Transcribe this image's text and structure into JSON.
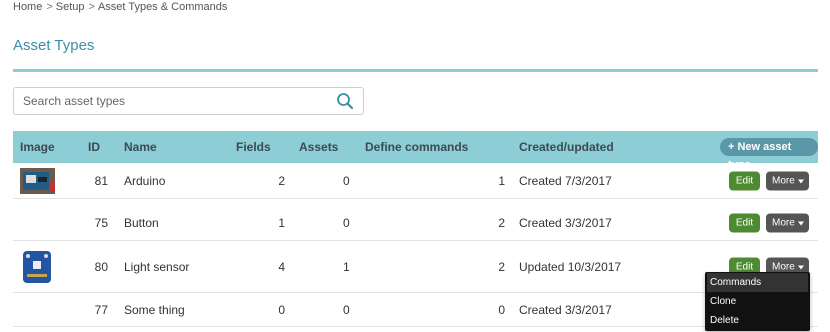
{
  "breadcrumb": [
    "Home",
    "Setup",
    "Asset Types & Commands"
  ],
  "page_title": "Asset Types",
  "search": {
    "placeholder": "Search asset types"
  },
  "table": {
    "headers": {
      "image": "Image",
      "id": "ID",
      "name": "Name",
      "fields": "Fields",
      "assets": "Assets",
      "define_commands": "Define commands",
      "created_updated": "Created/updated"
    },
    "new_button": "+ New asset type",
    "edit_label": "Edit",
    "more_label": "More",
    "rows": [
      {
        "image": "arduino-board-photo",
        "id": "81",
        "name": "Arduino",
        "fields": "2",
        "assets": "0",
        "define_commands": "1",
        "created_updated": "Created 7/3/2017"
      },
      {
        "image": "",
        "id": "75",
        "name": "Button",
        "fields": "1",
        "assets": "0",
        "define_commands": "2",
        "created_updated": "Created 3/3/2017"
      },
      {
        "image": "light-sensor-board-photo",
        "id": "80",
        "name": "Light sensor",
        "fields": "4",
        "assets": "1",
        "define_commands": "2",
        "created_updated": "Updated 10/3/2017"
      },
      {
        "image": "",
        "id": "77",
        "name": "Some thing",
        "fields": "0",
        "assets": "0",
        "define_commands": "0",
        "created_updated": "Created 3/3/2017"
      }
    ]
  },
  "more_menu": {
    "items": [
      "Commands",
      "Clone",
      "Delete"
    ],
    "highlighted": "Commands"
  },
  "colors": {
    "header_bg": "#8ccdd6",
    "title": "#3a8fa6",
    "edit_btn": "#4e8a32",
    "more_btn": "#555555",
    "new_btn": "#5a97a8"
  }
}
